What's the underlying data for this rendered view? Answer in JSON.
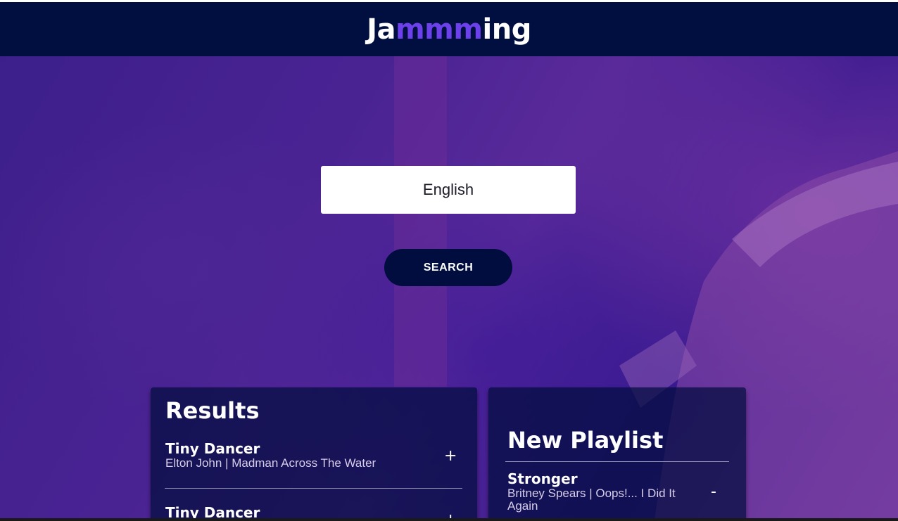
{
  "header": {
    "logo_prefix": "Ja",
    "logo_highlight": "mmm",
    "logo_suffix": "ing"
  },
  "search": {
    "value": "English",
    "button_label": "SEARCH"
  },
  "results": {
    "title": "Results",
    "tracks": [
      {
        "name": "Tiny Dancer",
        "info": "Elton John | Madman Across The Water",
        "action": "+"
      },
      {
        "name": "Tiny Dancer",
        "info": "",
        "action": "+"
      }
    ]
  },
  "playlist": {
    "title": "New Playlist",
    "tracks": [
      {
        "name": "Stronger",
        "info_line1": "Britney Spears | Oops!... I Did It",
        "info_line2": "Again",
        "action": "-"
      }
    ]
  }
}
